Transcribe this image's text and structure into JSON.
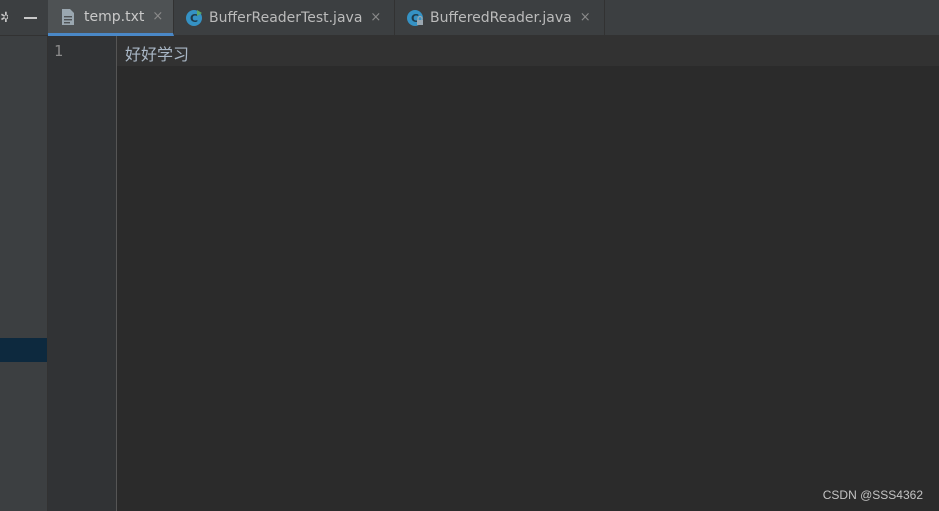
{
  "side_panel": {
    "toolbar": {
      "settings_icon": "gear-icon",
      "minimize_icon": "minimize-icon"
    }
  },
  "tabs": [
    {
      "label": "temp.txt",
      "icon": "text-file-icon",
      "active": true,
      "close": "×"
    },
    {
      "label": "BufferReaderTest.java",
      "icon": "java-class-run-icon",
      "active": false,
      "close": "×"
    },
    {
      "label": "BufferedReader.java",
      "icon": "java-class-locked-icon",
      "active": false,
      "close": "×"
    }
  ],
  "editor": {
    "line_numbers": [
      "1"
    ],
    "lines": [
      "好好学习"
    ]
  },
  "watermark": "CSDN @SSS4362",
  "colors": {
    "background": "#2b2b2b",
    "tab_bar": "#3c3f41",
    "active_tab_underline": "#4a88c7",
    "selection": "#0d293e",
    "text": "#a9b7c6"
  }
}
